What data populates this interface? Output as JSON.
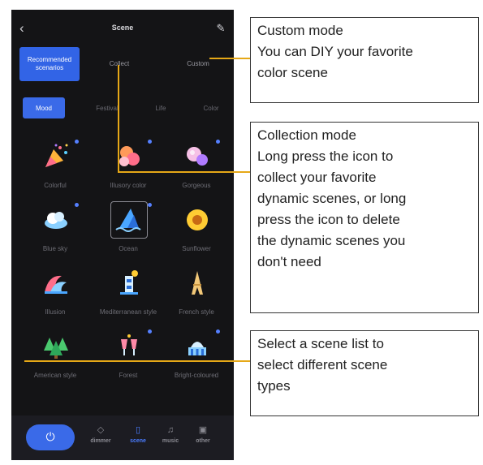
{
  "app": {
    "title": "Scene",
    "back_icon": "chevron-left-icon",
    "edit_icon": "pencil-icon"
  },
  "modes": [
    {
      "label": "Recommended scenarios",
      "active": true
    },
    {
      "label": "Collect",
      "active": false
    },
    {
      "label": "Custom",
      "active": false
    }
  ],
  "categories": [
    {
      "label": "Mood",
      "active": true
    },
    {
      "label": "Festival",
      "active": false
    },
    {
      "label": "Life",
      "active": false
    },
    {
      "label": "Color",
      "active": false
    }
  ],
  "scenes": [
    {
      "label": "Colorful",
      "icon": "party-popper-icon",
      "dot": true
    },
    {
      "label": "Illusory color",
      "icon": "bubbles-icon",
      "dot": true
    },
    {
      "label": "Gorgeous",
      "icon": "orbs-icon",
      "dot": true
    },
    {
      "label": "Blue sky",
      "icon": "cloud-icon",
      "dot": true
    },
    {
      "label": "Ocean",
      "icon": "shark-icon",
      "dot": true,
      "selected": true
    },
    {
      "label": "Sunflower",
      "icon": "sunflower-icon",
      "dot": false
    },
    {
      "label": "Illusion",
      "icon": "wave-icon",
      "dot": false
    },
    {
      "label": "Mediterranean style",
      "icon": "lighthouse-icon",
      "dot": false
    },
    {
      "label": "French style",
      "icon": "eiffel-tower-icon",
      "dot": false
    },
    {
      "label": "American style",
      "icon": "trees-icon",
      "dot": false
    },
    {
      "label": "Forest",
      "icon": "toast-icon",
      "dot": true
    },
    {
      "label": "Bright-coloured",
      "icon": "capitol-icon",
      "dot": true
    }
  ],
  "dock": {
    "power_icon": "power-icon",
    "tabs": [
      {
        "label": "dimmer",
        "icon": "bulb-icon",
        "active": false
      },
      {
        "label": "scene",
        "icon": "scene-icon",
        "active": true
      },
      {
        "label": "music",
        "icon": "music-icon",
        "active": false
      },
      {
        "label": "other",
        "icon": "other-icon",
        "active": false
      }
    ]
  },
  "callouts": {
    "custom": [
      "Custom mode",
      "You can DIY your favorite",
      "color scene"
    ],
    "collection": [
      "Collection mode",
      "Long press the icon to",
      "collect your favorite",
      "dynamic scenes, or long",
      "press the icon to delete",
      "the dynamic scenes you",
      "don't need"
    ],
    "select": [
      "Select a scene list to",
      "select different scene",
      "types"
    ]
  },
  "colors": {
    "accent": "#3a6ae8",
    "background": "#141416",
    "callout_line": "#e6a817"
  }
}
